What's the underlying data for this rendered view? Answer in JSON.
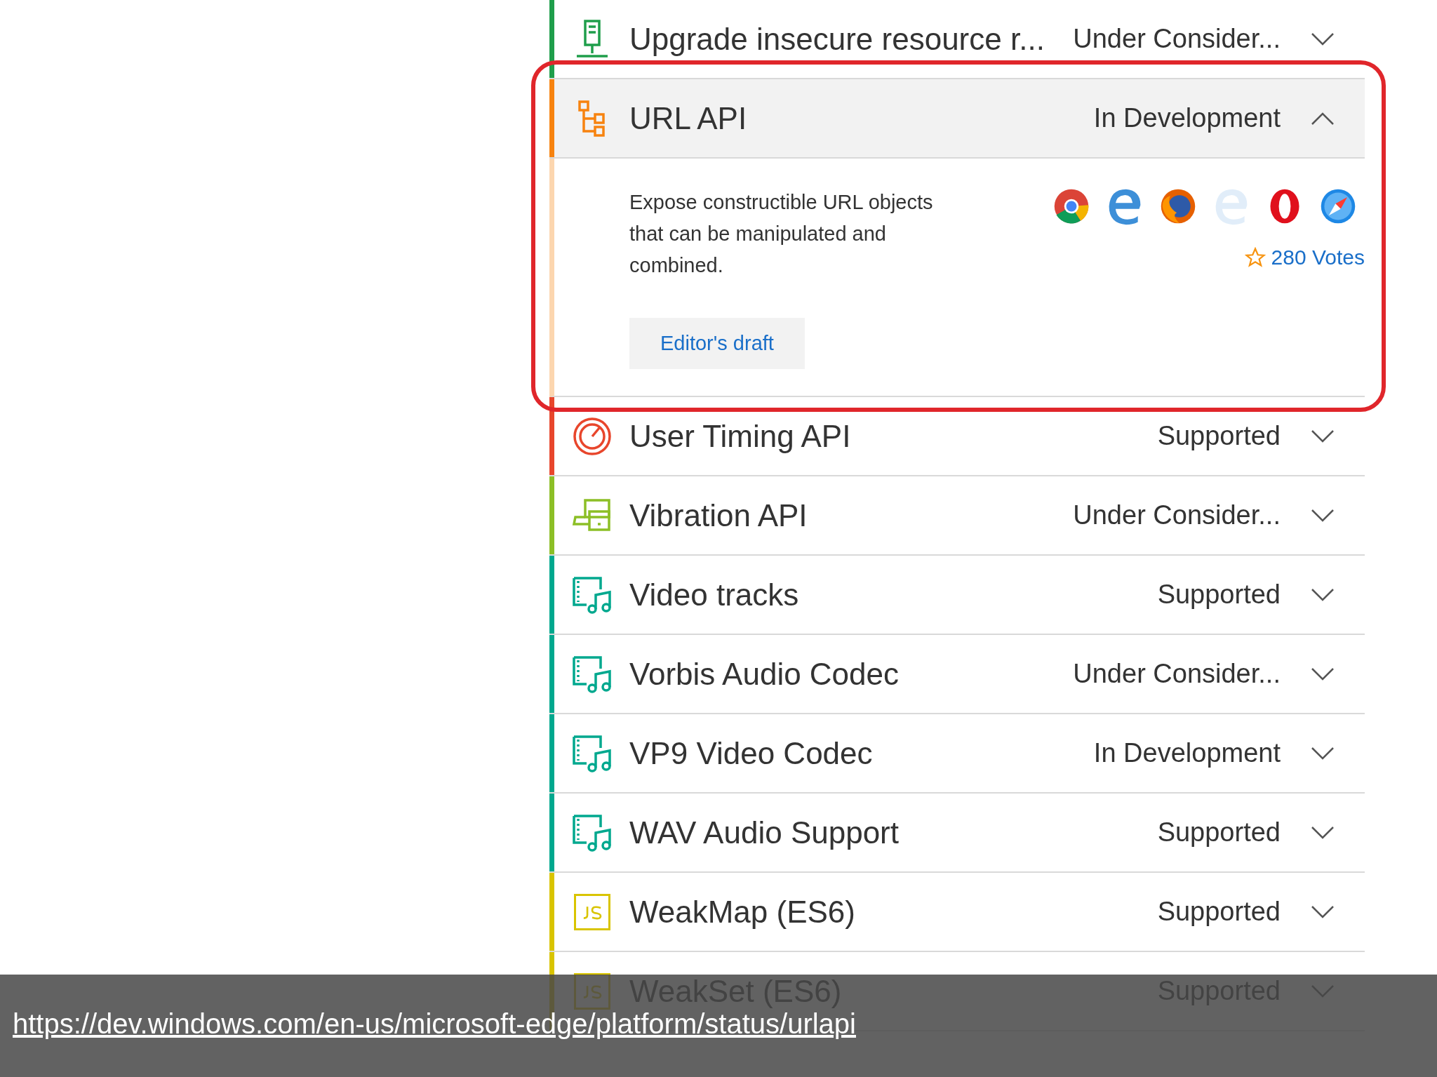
{
  "features": [
    {
      "title": "Upgrade insecure resource r...",
      "status": "Under Consider...",
      "kind": "network",
      "color": "#1f9e4b",
      "expanded": false
    },
    {
      "title": "URL API",
      "status": "In Development",
      "kind": "hierarchy",
      "color": "#f7830f",
      "expanded": true,
      "description": "Expose constructible URL objects that can be manipulated and combined.",
      "browsers": [
        {
          "kind": "chrome",
          "supported": true
        },
        {
          "kind": "edge",
          "supported": true
        },
        {
          "kind": "firefox",
          "supported": true
        },
        {
          "kind": "ie",
          "supported": false
        },
        {
          "kind": "opera",
          "supported": true
        },
        {
          "kind": "safari",
          "supported": true
        }
      ],
      "votes": "280 Votes",
      "link": "Editor's draft"
    },
    {
      "title": "User Timing API",
      "status": "Supported",
      "kind": "gauge",
      "color": "#e8462c",
      "expanded": false
    },
    {
      "title": "Vibration API",
      "status": "Under Consider...",
      "kind": "devices",
      "color": "#8cbf26",
      "expanded": false
    },
    {
      "title": "Video tracks",
      "status": "Supported",
      "kind": "media",
      "color": "#00a88e",
      "expanded": false
    },
    {
      "title": "Vorbis Audio Codec",
      "status": "Under Consider...",
      "kind": "media",
      "color": "#00a88e",
      "expanded": false
    },
    {
      "title": "VP9 Video Codec",
      "status": "In Development",
      "kind": "media",
      "color": "#00a88e",
      "expanded": false
    },
    {
      "title": "WAV Audio Support",
      "status": "Supported",
      "kind": "media",
      "color": "#00a88e",
      "expanded": false
    },
    {
      "title": "WeakMap (ES6)",
      "status": "Supported",
      "kind": "js",
      "color": "#d9c400",
      "expanded": false
    },
    {
      "title": "WeakSet (ES6)",
      "status": "Supported",
      "kind": "js",
      "color": "#d9c400",
      "expanded": false
    }
  ],
  "source_link": "https://dev.windows.com/en-us/microsoft-edge/platform/status/urlapi"
}
